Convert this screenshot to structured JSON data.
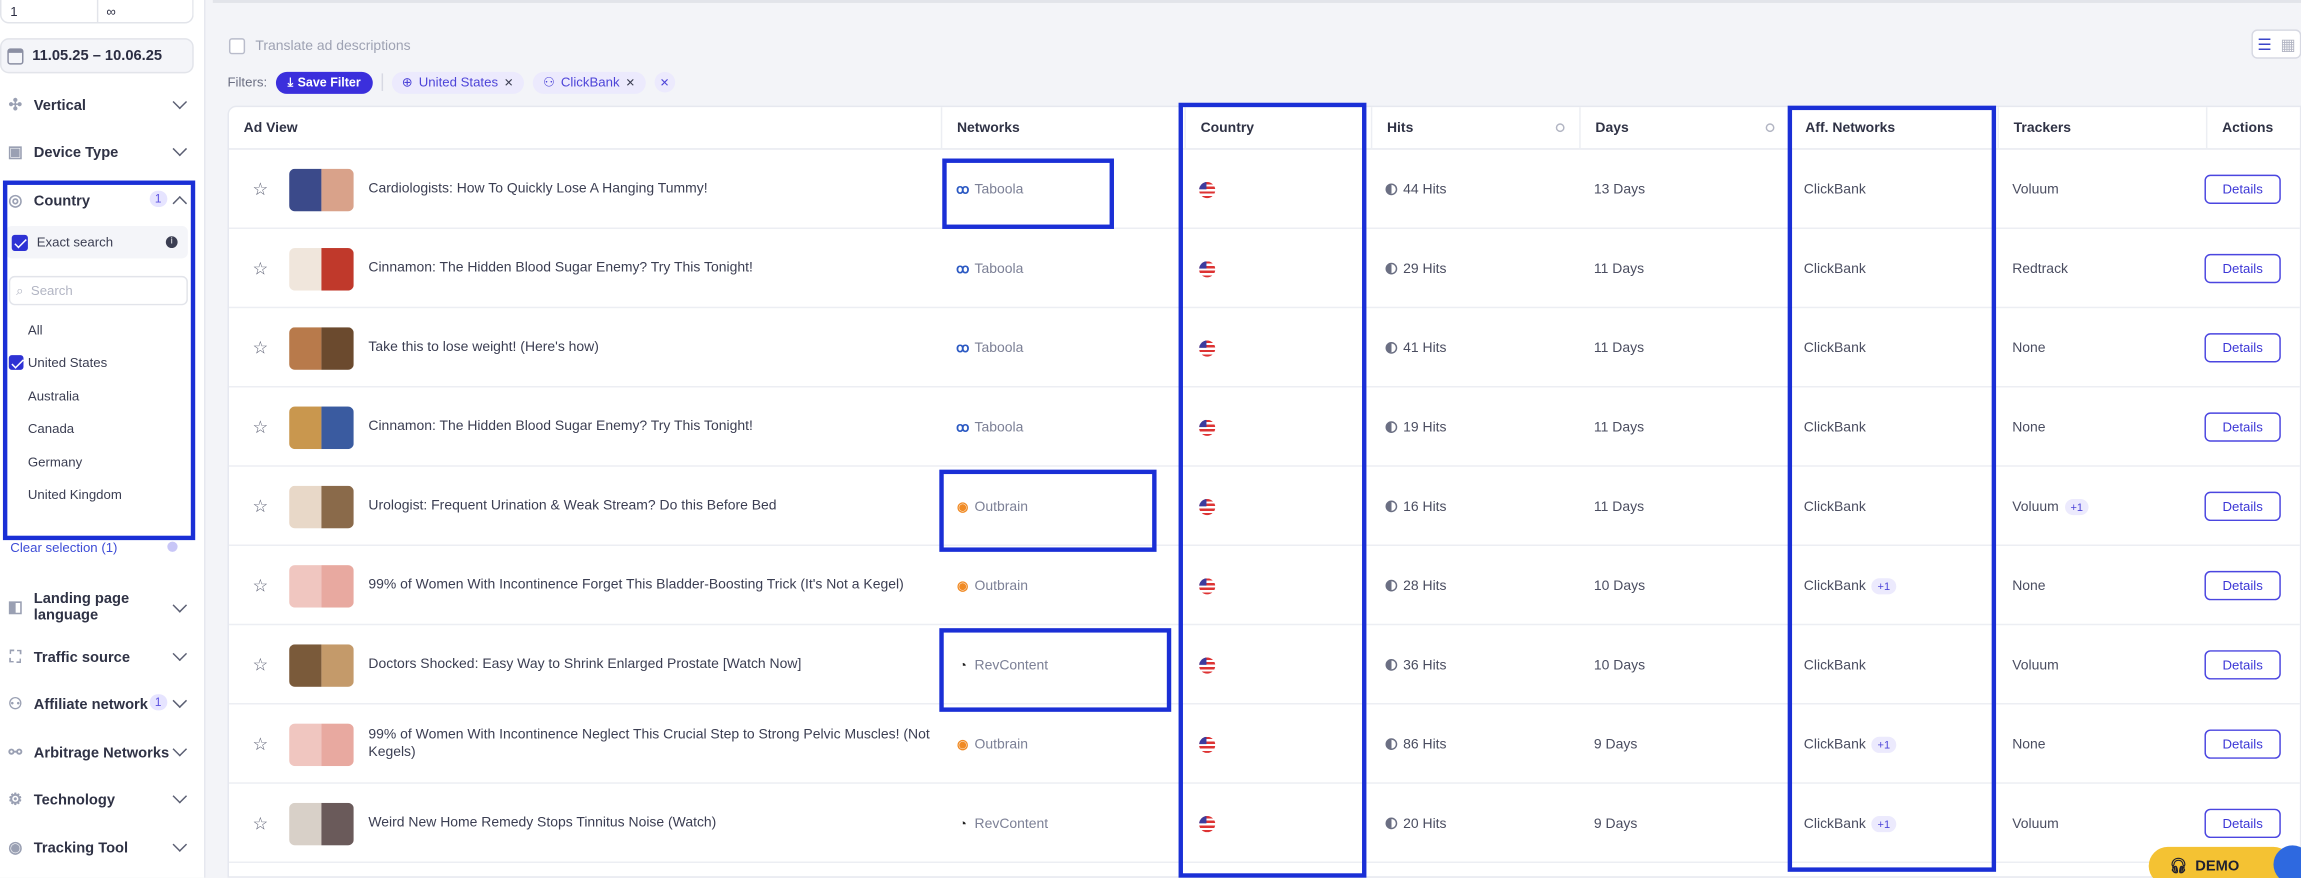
{
  "sidebar": {
    "range_min": "1",
    "range_max": "∞",
    "date_range": "11.05.25 – 10.06.25",
    "filters": {
      "vertical": "Vertical",
      "device_type": "Device Type",
      "country": "Country",
      "country_count": "1",
      "landing_page_language": "Landing page language",
      "traffic_source": "Traffic source",
      "affiliate_network": "Affiliate network",
      "affiliate_count": "1",
      "arbitrage_networks": "Arbitrage Networks",
      "technology": "Technology",
      "tracking_tool": "Tracking Tool"
    },
    "country_panel": {
      "exact_search": "Exact search",
      "search_placeholder": "Search",
      "options": [
        "All",
        "United States",
        "Australia",
        "Canada",
        "Germany",
        "United Kingdom"
      ],
      "clear_selection": "Clear selection (1)"
    }
  },
  "toolbar": {
    "translate": "Translate ad descriptions",
    "filters_label": "Filters:",
    "save_filter": "Save Filter",
    "chips": [
      "United States",
      "ClickBank"
    ]
  },
  "table": {
    "headers": {
      "ad_view": "Ad View",
      "networks": "Networks",
      "country": "Country",
      "hits": "Hits",
      "days": "Days",
      "aff_networks": "Aff. Networks",
      "trackers": "Trackers",
      "actions": "Actions"
    },
    "details_label": "Details",
    "rows": [
      {
        "title": "Cardiologists: How To Quickly Lose A Hanging Tummy!",
        "network": "Taboola",
        "hits": "44 Hits",
        "days": "13 Days",
        "aff": "ClickBank",
        "aff_plus": "",
        "tracker": "Voluum",
        "tracker_plus": ""
      },
      {
        "title": "Cinnamon: The Hidden Blood Sugar Enemy? Try This Tonight!",
        "network": "Taboola",
        "hits": "29 Hits",
        "days": "11 Days",
        "aff": "ClickBank",
        "aff_plus": "",
        "tracker": "Redtrack",
        "tracker_plus": ""
      },
      {
        "title": "Take this to lose weight! (Here's how)",
        "network": "Taboola",
        "hits": "41 Hits",
        "days": "11 Days",
        "aff": "ClickBank",
        "aff_plus": "",
        "tracker": "None",
        "tracker_plus": ""
      },
      {
        "title": "Cinnamon: The Hidden Blood Sugar Enemy? Try This Tonight!",
        "network": "Taboola",
        "hits": "19 Hits",
        "days": "11 Days",
        "aff": "ClickBank",
        "aff_plus": "",
        "tracker": "None",
        "tracker_plus": ""
      },
      {
        "title": "Urologist: Frequent Urination & Weak Stream? Do this Before Bed",
        "network": "Outbrain",
        "hits": "16 Hits",
        "days": "11 Days",
        "aff": "ClickBank",
        "aff_plus": "",
        "tracker": "Voluum",
        "tracker_plus": "+1"
      },
      {
        "title": "99% of Women With Incontinence Forget This Bladder-Boosting Trick (It's Not a Kegel)",
        "network": "Outbrain",
        "hits": "28 Hits",
        "days": "10 Days",
        "aff": "ClickBank",
        "aff_plus": "+1",
        "tracker": "None",
        "tracker_plus": ""
      },
      {
        "title": "Doctors Shocked: Easy Way to Shrink Enlarged Prostate [Watch Now]",
        "network": "RevContent",
        "hits": "36 Hits",
        "days": "10 Days",
        "aff": "ClickBank",
        "aff_plus": "",
        "tracker": "Voluum",
        "tracker_plus": ""
      },
      {
        "title": "99% of Women With Incontinence Neglect This Crucial Step to Strong Pelvic Muscles! (Not Kegels)",
        "network": "Outbrain",
        "hits": "86 Hits",
        "days": "9 Days",
        "aff": "ClickBank",
        "aff_plus": "+1",
        "tracker": "None",
        "tracker_plus": ""
      },
      {
        "title": "Weird New Home Remedy Stops Tinnitus Noise (Watch)",
        "network": "RevContent",
        "hits": "20 Hits",
        "days": "9 Days",
        "aff": "ClickBank",
        "aff_plus": "+1",
        "tracker": "Voluum",
        "tracker_plus": ""
      }
    ]
  },
  "demo_label": "DEMO",
  "colors": {
    "accent": "#3b2fdc",
    "highlight": "#1a2fd6",
    "demo": "#f4c233"
  }
}
